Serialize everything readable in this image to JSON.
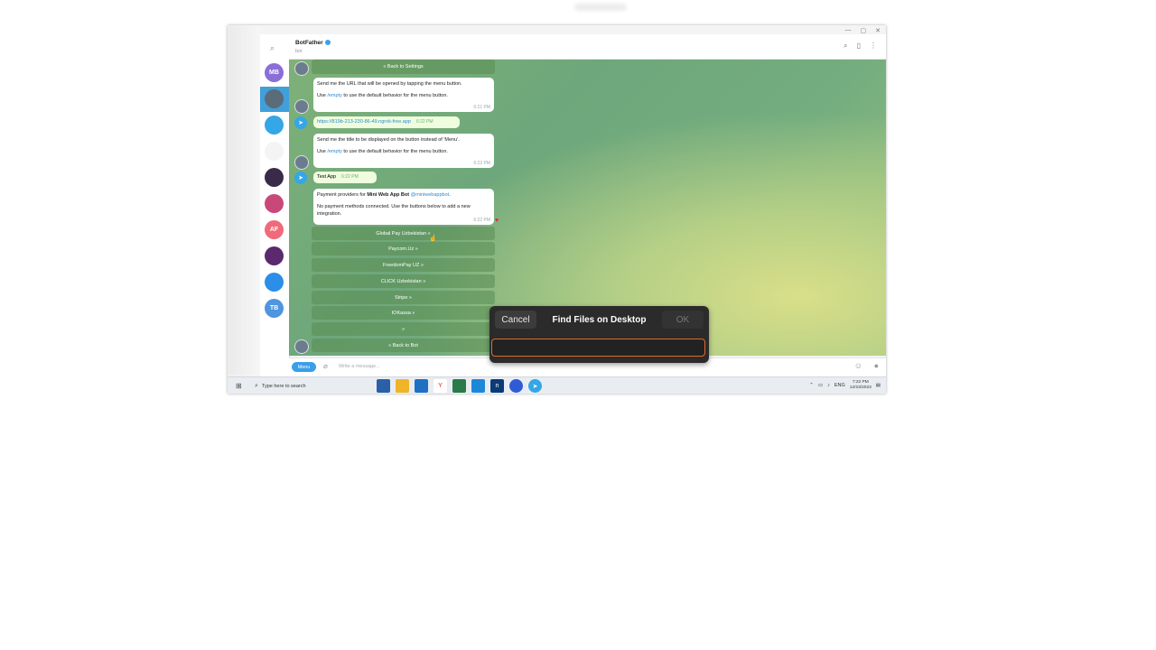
{
  "window": {
    "controls": [
      "—",
      "▢",
      "✕"
    ]
  },
  "chat": {
    "name": "BotFather",
    "subtitle": "bot",
    "messages": {
      "back_to_settings": "« Back to Settings",
      "m1_line1": "Send me the URL that will be opened by tapping the menu button.",
      "m1_line2_pre": "Use ",
      "m1_link": "/empty",
      "m1_line2_post": " to use the default behavior for the menu button.",
      "m1_time": "6:21 PM",
      "out1_text": "https://819b-213-230-86-49.ngrok-free.app",
      "out1_time": "6:22 PM",
      "m2_line1": "Send me the title to be displayed on the button instead of 'Menu'.",
      "m2_line2_pre": "Use ",
      "m2_link": "/empty",
      "m2_line2_post": " to use the default behavior for the menu button.",
      "m2_time": "6:22 PM",
      "out2_text": "Test App",
      "out2_time": "6:22 PM",
      "m3_pre": "Payment providers for ",
      "m3_bold": "Mini Web App Bot",
      "m3_link": "@miniwebappbot",
      "m3_post": ".",
      "m3_line2": "No payment methods connected. Use the buttons below to add a new integration.",
      "m3_time": "6:22 PM"
    },
    "keyboard": [
      "Global Pay Uzbekistan »",
      "Paycom.Uz »",
      "FreedomPay UZ »",
      "CLICK Uzbekistan »",
      "Stripe »",
      "IOKassa »",
      "»",
      "« Back to Bot"
    ],
    "composer": {
      "menu_label": "Menu",
      "placeholder": "Write a message..."
    }
  },
  "chatlist": {
    "avatars": [
      {
        "label": "MB",
        "color": "#8b6fd6"
      },
      {
        "label": "",
        "color": "#5a6b7a"
      },
      {
        "label": "",
        "color": "#35a6e6"
      },
      {
        "label": "",
        "color": "#f4f4f4"
      },
      {
        "label": "",
        "color": "#3a2a4a"
      },
      {
        "label": "",
        "color": "#c9487a"
      },
      {
        "label": "AF",
        "color": "#ef6a7a"
      },
      {
        "label": "",
        "color": "#5b2a6e"
      },
      {
        "label": "",
        "color": "#2b8ee8"
      },
      {
        "label": "TB",
        "color": "#4f95e0"
      }
    ]
  },
  "dialog": {
    "cancel": "Cancel",
    "title": "Find Files on Desktop",
    "ok": "OK",
    "input_value": ""
  },
  "taskbar": {
    "search_label": "Type here to search",
    "lang": "ENG",
    "time": "7:22 PM",
    "date": "12/23/2023"
  }
}
